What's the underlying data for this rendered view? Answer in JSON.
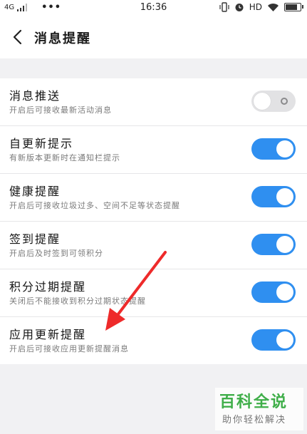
{
  "status_bar": {
    "network": "4G",
    "dots": "•••",
    "time": "16:36",
    "hd": "HD"
  },
  "header": {
    "title": "消息提醒",
    "back_icon": "chevron-left-icon"
  },
  "settings": [
    {
      "title": "消息推送",
      "desc": "开启后可接收最新活动消息",
      "enabled": false
    },
    {
      "title": "自更新提示",
      "desc": "有新版本更新时在通知栏提示",
      "enabled": true
    },
    {
      "title": "健康提醒",
      "desc": "开启后可接收垃圾过多、空间不足等状态提醒",
      "enabled": true
    },
    {
      "title": "签到提醒",
      "desc": "开启后及时签到可领积分",
      "enabled": true
    },
    {
      "title": "积分过期提醒",
      "desc": "关闭后不能接收到积分过期状态提醒",
      "enabled": true
    },
    {
      "title": "应用更新提醒",
      "desc": "开启后可接收应用更新提醒消息",
      "enabled": true
    }
  ],
  "colors": {
    "toggle_on": "#2f8ff0",
    "toggle_off": "#e2e2e4",
    "annotation_arrow": "#ee2a2a",
    "watermark_green": "#3fae49"
  },
  "watermark": {
    "title": "百科全说",
    "subtitle": "助你轻松解决"
  }
}
